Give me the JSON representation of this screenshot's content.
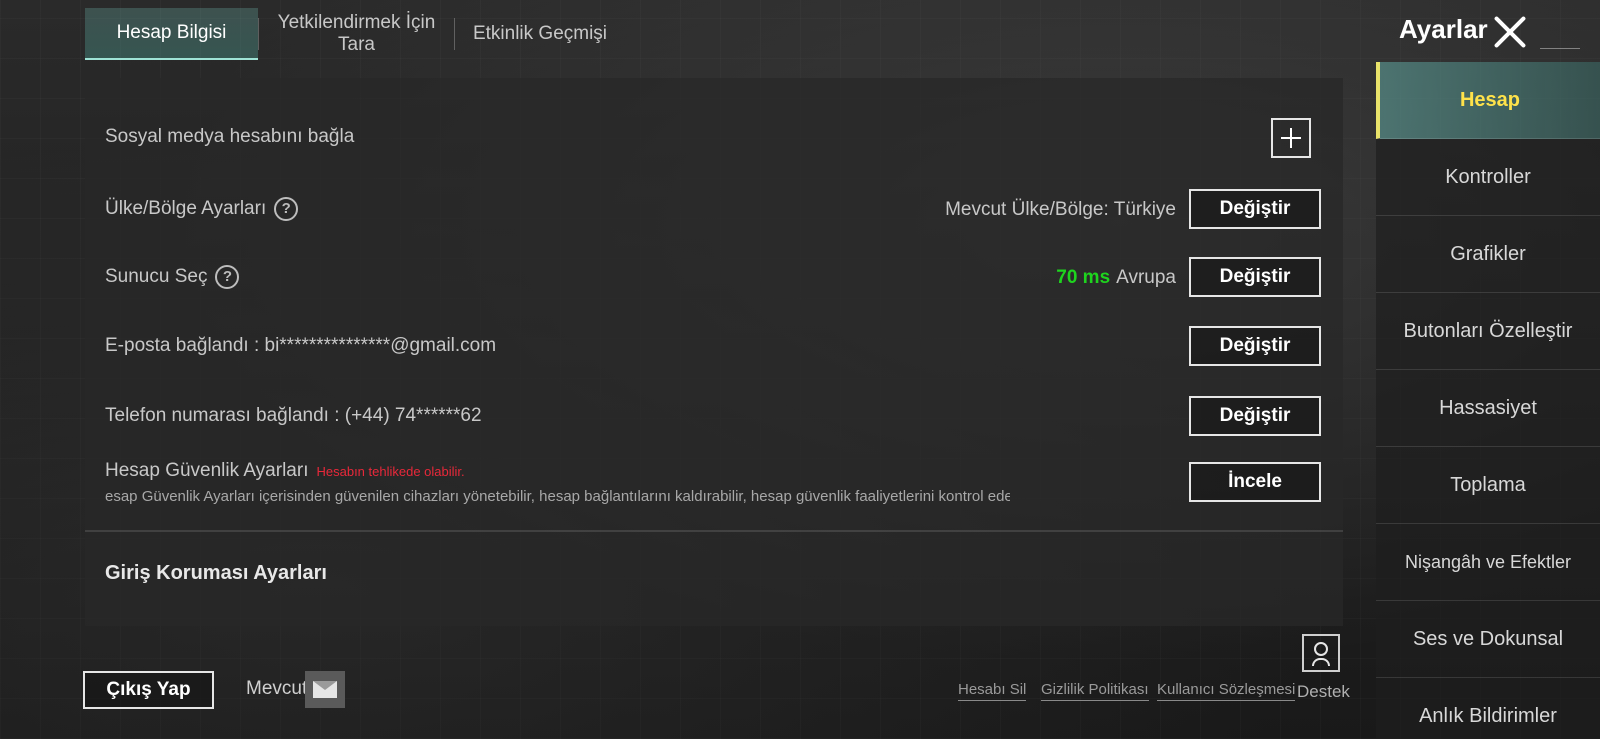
{
  "header": {
    "tabs": [
      {
        "label": "Hesap Bilgisi",
        "active": true
      },
      {
        "label": "Yetkilendirmek İçin Tara",
        "active": false
      },
      {
        "label": "Etkinlik Geçmişi",
        "active": false
      }
    ],
    "title": "Ayarlar"
  },
  "rows": {
    "social": {
      "label": "Sosyal medya hesabını bağla"
    },
    "region": {
      "label": "Ülke/Bölge Ayarları",
      "info": "Mevcut Ülke/Bölge: Türkiye",
      "button": "Değiştir"
    },
    "server": {
      "label": "Sunucu Seç",
      "ping": "70 ms",
      "region": "Avrupa",
      "button": "Değiştir"
    },
    "email": {
      "label": "E-posta bağlandı : bi***************@gmail.com",
      "button": "Değiştir"
    },
    "phone": {
      "label": "Telefon numarası bağlandı : (+44) 74******62",
      "button": "Değiştir"
    },
    "security": {
      "label": "Hesap Güvenlik Ayarları",
      "warning": "Hesabın tehlikede olabilir.",
      "description": "esap Güvenlik Ayarları içerisinden güvenilen cihazları yönetebilir, hesap bağlantılarını kaldırabilir, hesap güvenlik faaliyetlerini kontrol edebilir ve",
      "button": "İncele"
    },
    "login_protection": {
      "title": "Giriş Koruması Ayarları"
    }
  },
  "sidenav": [
    {
      "label": "Hesap",
      "active": true
    },
    {
      "label": "Kontroller",
      "active": false
    },
    {
      "label": "Grafikler",
      "active": false
    },
    {
      "label": "Butonları Özelleştir",
      "active": false
    },
    {
      "label": "Hassasiyet",
      "active": false
    },
    {
      "label": "Toplama",
      "active": false
    },
    {
      "label": "Nişangâh ve Efektler",
      "active": false
    },
    {
      "label": "Ses ve Dokunsal",
      "active": false
    },
    {
      "label": "Anlık Bildirimler",
      "active": false
    }
  ],
  "footer": {
    "logout": "Çıkış Yap",
    "current": "Mevcut",
    "links": [
      "Hesabı Sil",
      "Gizlilik Politikası",
      "Kullanıcı Sözleşmesi"
    ],
    "support": "Destek"
  },
  "colors": {
    "accent": "#9fe3d6",
    "active_nav_text": "#ffe24a",
    "ping": "#1ed41e",
    "warning": "#e8283a"
  }
}
